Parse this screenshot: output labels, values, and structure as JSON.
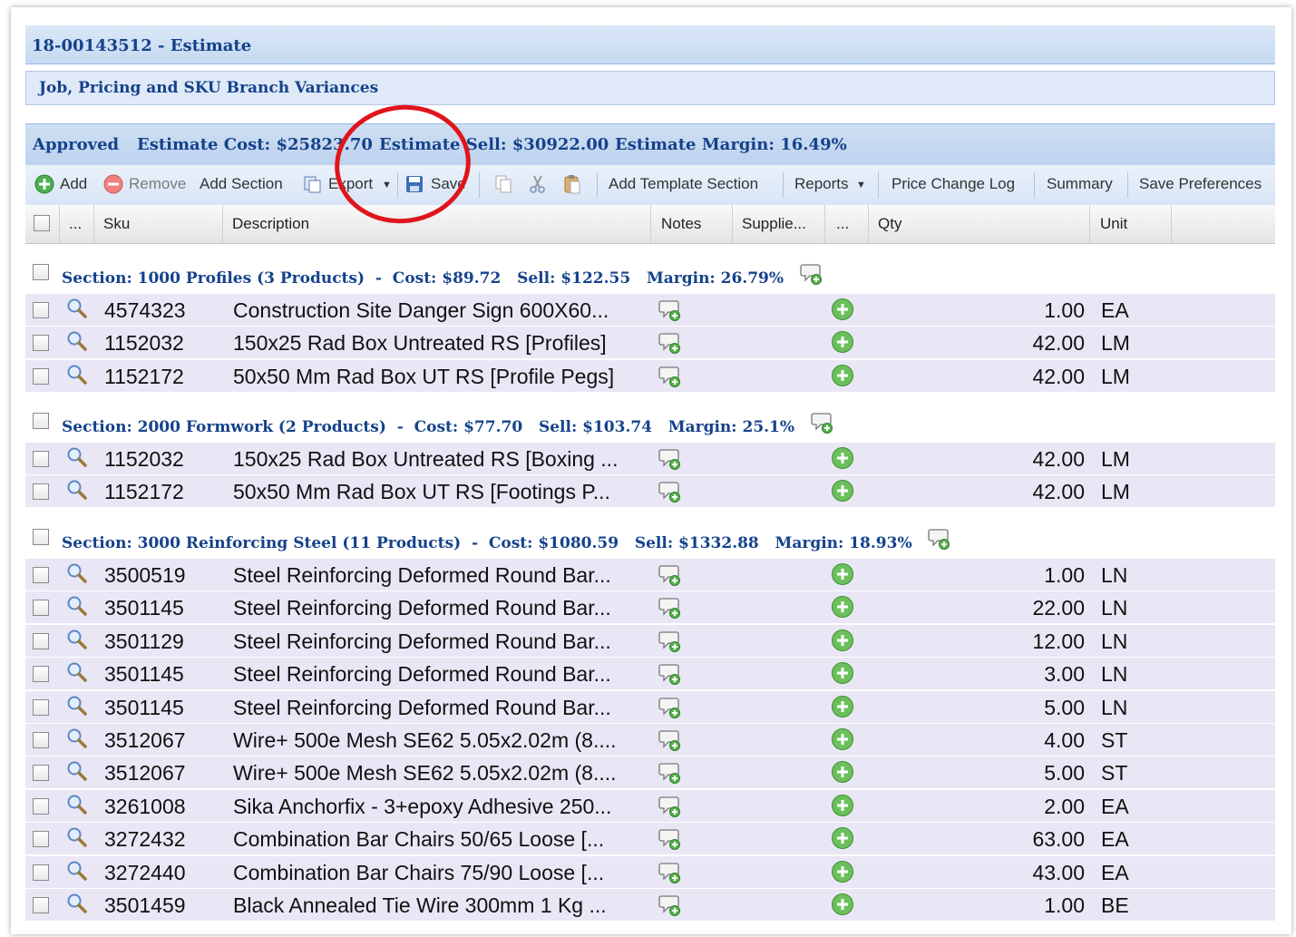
{
  "window_title": "18-00143512 - Estimate",
  "panel_title": "Job, Pricing and SKU Branch Variances",
  "status": {
    "approved": "Approved",
    "cost": "Estimate Cost: $25823.70",
    "sell": "Estimate Sell: $30922.00",
    "margin": "Estimate Margin: 16.49%"
  },
  "toolbar": {
    "add": "Add",
    "remove": "Remove",
    "add_section": "Add Section",
    "export": "Export",
    "save": "Save",
    "add_template": "Add Template Section",
    "reports": "Reports",
    "price_log": "Price Change Log",
    "summary": "Summary",
    "save_prefs": "Save Preferences"
  },
  "columns": {
    "more": "...",
    "sku": "Sku",
    "description": "Description",
    "notes": "Notes",
    "supplier": "Supplie...",
    "more2": "...",
    "qty": "Qty",
    "unit": "Unit"
  },
  "sections": [
    {
      "title": "Section: 1000 Profiles (3 Products)",
      "cost": "Cost: $89.72",
      "sell": "Sell: $122.55",
      "margin": "Margin: 26.79%",
      "rows": [
        {
          "sku": "4574323",
          "desc": "Construction Site Danger Sign 600X60...",
          "qty": "1.00",
          "unit": "EA"
        },
        {
          "sku": "1152032",
          "desc": "150x25 Rad Box Untreated RS [Profiles]",
          "qty": "42.00",
          "unit": "LM"
        },
        {
          "sku": "1152172",
          "desc": "50x50 Mm Rad Box UT RS [Profile Pegs]",
          "qty": "42.00",
          "unit": "LM"
        }
      ]
    },
    {
      "title": "Section: 2000 Formwork (2 Products)",
      "cost": "Cost: $77.70",
      "sell": "Sell: $103.74",
      "margin": "Margin: 25.1%",
      "rows": [
        {
          "sku": "1152032",
          "desc": "150x25 Rad Box Untreated RS [Boxing ...",
          "qty": "42.00",
          "unit": "LM"
        },
        {
          "sku": "1152172",
          "desc": "50x50 Mm Rad Box UT RS [Footings P...",
          "qty": "42.00",
          "unit": "LM"
        }
      ]
    },
    {
      "title": "Section: 3000 Reinforcing Steel (11 Products)",
      "cost": "Cost: $1080.59",
      "sell": "Sell: $1332.88",
      "margin": "Margin: 18.93%",
      "rows": [
        {
          "sku": "3500519",
          "desc": "Steel Reinforcing Deformed Round Bar...",
          "qty": "1.00",
          "unit": "LN"
        },
        {
          "sku": "3501145",
          "desc": "Steel Reinforcing Deformed Round Bar...",
          "qty": "22.00",
          "unit": "LN"
        },
        {
          "sku": "3501129",
          "desc": "Steel Reinforcing Deformed Round Bar...",
          "qty": "12.00",
          "unit": "LN"
        },
        {
          "sku": "3501145",
          "desc": "Steel Reinforcing Deformed Round Bar...",
          "qty": "3.00",
          "unit": "LN"
        },
        {
          "sku": "3501145",
          "desc": "Steel Reinforcing Deformed Round Bar...",
          "qty": "5.00",
          "unit": "LN"
        },
        {
          "sku": "3512067",
          "desc": "Wire+ 500e Mesh SE62 5.05x2.02m (8....",
          "qty": "4.00",
          "unit": "ST"
        },
        {
          "sku": "3512067",
          "desc": "Wire+ 500e Mesh SE62 5.05x2.02m (8....",
          "qty": "5.00",
          "unit": "ST"
        },
        {
          "sku": "3261008",
          "desc": "Sika Anchorfix - 3+epoxy Adhesive 250...",
          "qty": "2.00",
          "unit": "EA"
        },
        {
          "sku": "3272432",
          "desc": "Combination Bar Chairs 50/65 Loose [...",
          "qty": "63.00",
          "unit": "EA"
        },
        {
          "sku": "3272440",
          "desc": "Combination Bar Chairs 75/90 Loose [...",
          "qty": "43.00",
          "unit": "EA"
        },
        {
          "sku": "3501459",
          "desc": "Black Annealed Tie Wire 300mm 1 Kg ...",
          "qty": "1.00",
          "unit": "BE"
        }
      ]
    }
  ],
  "colors": {
    "header_text": "#15428b",
    "row_bg": "#e9e7f5",
    "annotation": "#e0151b"
  }
}
